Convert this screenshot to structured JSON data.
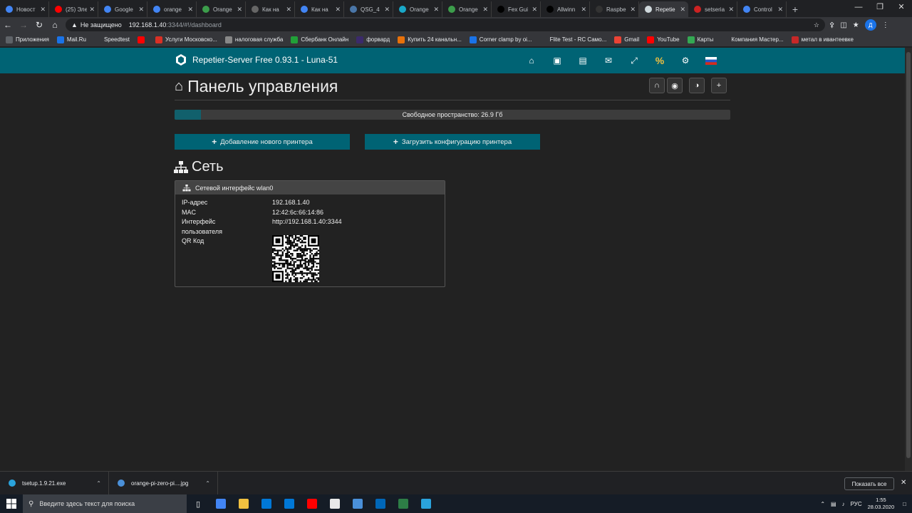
{
  "browser": {
    "tabs": [
      {
        "label": "Новост",
        "color": "#4285f4"
      },
      {
        "label": "(25) Эле",
        "color": "#ff0000"
      },
      {
        "label": "Google",
        "color": "#4285f4"
      },
      {
        "label": "orange",
        "color": "#4285f4"
      },
      {
        "label": "Orange",
        "color": "#3c9d4b"
      },
      {
        "label": "Как на",
        "color": "#666666"
      },
      {
        "label": "Как на",
        "color": "#4285f4"
      },
      {
        "label": "QSG_4",
        "color": "#4a76a8"
      },
      {
        "label": "Orange",
        "color": "#19a8c8"
      },
      {
        "label": "Orange",
        "color": "#3c9d4b"
      },
      {
        "label": "Fex Gui",
        "color": "#000000"
      },
      {
        "label": "Allwinn",
        "color": "#000000"
      },
      {
        "label": "Raspbe",
        "color": "#333333"
      },
      {
        "label": "Repetie",
        "color": "#cfd8dc",
        "active": true
      },
      {
        "label": "setseria",
        "color": "#cc2222"
      },
      {
        "label": "Control",
        "color": "#4285f4"
      }
    ],
    "address": {
      "insecure_label": "Не защищено",
      "host": "192.168.1.40",
      "path": ":3344/#!/dashboard"
    },
    "profile_initial": "Д",
    "bookmarks": [
      {
        "label": "Приложения",
        "color": "#5f6368"
      },
      {
        "label": "Mail.Ru",
        "color": "#1a73e8"
      },
      {
        "label": "Speedtest",
        "color": "#35363a"
      },
      {
        "label": "",
        "color": "#ff0000"
      },
      {
        "label": "Услуги Московско...",
        "color": "#d93025"
      },
      {
        "label": "налоговая служба",
        "color": "#888888"
      },
      {
        "label": "Сбербанк Онлайн",
        "color": "#21a038"
      },
      {
        "label": "форвард",
        "color": "#3b2a6b"
      },
      {
        "label": "Купить 24 канальн...",
        "color": "#e8710a"
      },
      {
        "label": "Corner clamp by oi...",
        "color": "#1a73e8"
      },
      {
        "label": "Flite Test - RC Само...",
        "color": "#35363a"
      },
      {
        "label": "Gmail",
        "color": "#ea4335"
      },
      {
        "label": "YouTube",
        "color": "#ff0000"
      },
      {
        "label": "Карты",
        "color": "#34a853"
      },
      {
        "label": "Компания Мастер...",
        "color": "#35363a"
      },
      {
        "label": "метал в ивантеевке",
        "color": "#c62828"
      }
    ]
  },
  "app": {
    "brand": "Repetier-Server Free 0.93.1 - Luna-51",
    "accent": "#006374",
    "title": "Панель управления",
    "storage": {
      "label": "Свободное пространство: 26.9 Гб",
      "fill_fraction": 0.048
    },
    "add_printer": "Добавление нового принтера",
    "upload_config": "Загрузить конфигурацию принтера",
    "section_title": "Сеть",
    "network": {
      "panel_title": "Сетевой интерфейс wlan0",
      "rows": [
        {
          "key": "IP-адрес",
          "value": "192.168.1.40"
        },
        {
          "key": "MAC",
          "value": "12:42:6c:66:14:86"
        },
        {
          "key": "Интерфейс",
          "value": "http://192.168.1.40:3344"
        },
        {
          "key": "пользователя",
          "value": ""
        },
        {
          "key": "QR Код",
          "value": ""
        }
      ]
    }
  },
  "downloads": {
    "items": [
      {
        "label": "tsetup.1.9.21.exe",
        "color": "#2aa3dc"
      },
      {
        "label": "orange-pi-zero-pi....jpg",
        "color": "#4a90d9"
      }
    ],
    "show_all": "Показать все"
  },
  "taskbar": {
    "search_placeholder": "Введите здесь текст для поиска",
    "apps": [
      "#4285f4",
      "#f0c040",
      "#0078d7",
      "#0078d7",
      "#ff0000",
      "#e8e8e8",
      "#4a90d9",
      "#0067b8",
      "#2d7d46",
      "#2aa3dc"
    ],
    "lang": "РУС",
    "time": "1:55",
    "date": "28.03.2020"
  }
}
